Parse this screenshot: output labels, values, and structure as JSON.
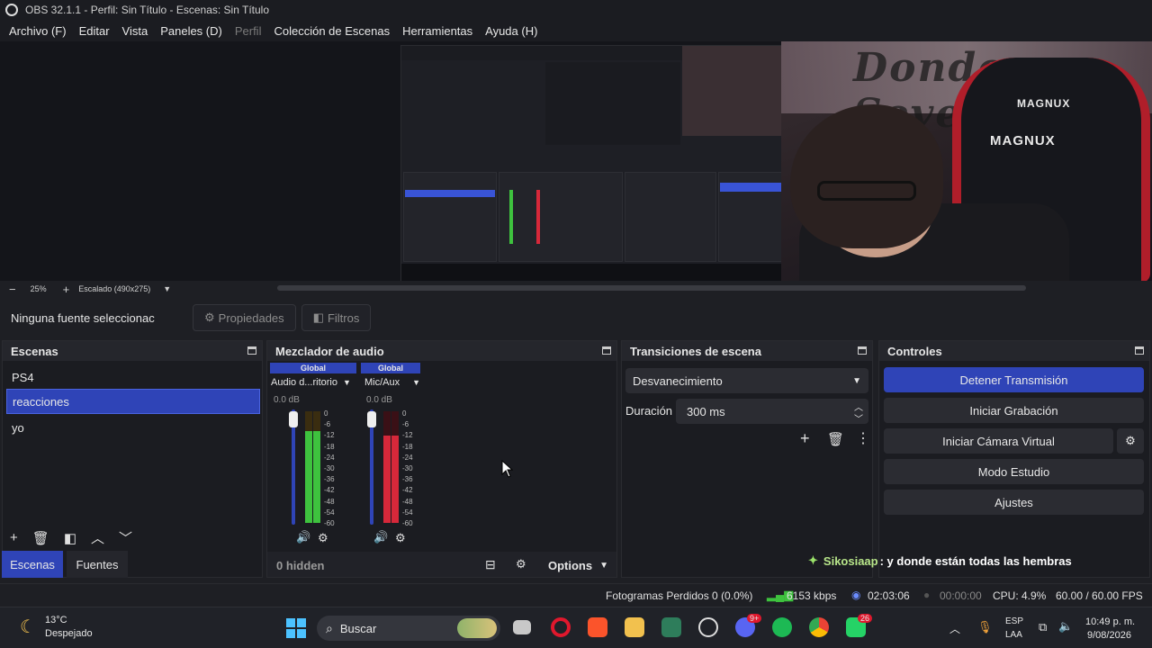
{
  "titlebar": {
    "title": "OBS 32.1.1 - Perfil: Sin Título - Escenas: Sin Título"
  },
  "menu": [
    {
      "label": "Archivo (F)",
      "enabled": true
    },
    {
      "label": "Editar",
      "enabled": true
    },
    {
      "label": "Vista",
      "enabled": true
    },
    {
      "label": "Paneles (D)",
      "enabled": true
    },
    {
      "label": "Perfil",
      "enabled": false
    },
    {
      "label": "Colección de Escenas",
      "enabled": true
    },
    {
      "label": "Herramientas",
      "enabled": true
    },
    {
      "label": "Ayuda (H)",
      "enabled": true
    }
  ],
  "webcam": {
    "graffiti_text": "Donde Seven",
    "chair_brand": "MAGNUX"
  },
  "zoombar": {
    "zoom_out": "−",
    "zoom": "25%",
    "zoom_in": "+",
    "scaling": "Escalado (490x275)"
  },
  "sourcebar": {
    "selection": "Ninguna fuente seleccionac",
    "properties": "Propiedades",
    "filters": "Filtros"
  },
  "scenes": {
    "title": "Escenas",
    "items": [
      {
        "label": "PS4",
        "selected": false
      },
      {
        "label": "reacciones",
        "selected": true
      },
      {
        "label": "yo",
        "selected": false
      }
    ],
    "tabs": [
      {
        "label": "Escenas",
        "active": true
      },
      {
        "label": "Fuentes",
        "active": false
      }
    ]
  },
  "mixer": {
    "title": "Mezclador de audio",
    "channels": [
      {
        "badge": "Global",
        "name": "Audio d...ritorio",
        "db": "0.0 dB",
        "level": 0.82
      },
      {
        "badge": "Global",
        "name": "Mic/Aux",
        "db": "0.0 dB",
        "level": 0.78
      }
    ],
    "ticks": [
      "0",
      "-6",
      "-12",
      "-18",
      "-24",
      "-30",
      "-36",
      "-42",
      "-48",
      "-54",
      "-60"
    ],
    "hidden": "0 hidden",
    "options": "Options"
  },
  "transitions": {
    "title": "Transiciones de escena",
    "selected": "Desvanecimiento",
    "duration_label": "Duración",
    "duration_value": "300 ms"
  },
  "controls": {
    "title": "Controles",
    "buttons": [
      {
        "label": "Detener Transmisión",
        "primary": true
      },
      {
        "label": "Iniciar Grabación",
        "primary": false
      },
      {
        "label": "Iniciar Cámara Virtual",
        "primary": false
      },
      {
        "label": "Modo Estudio",
        "primary": false
      },
      {
        "label": "Ajustes",
        "primary": false
      }
    ]
  },
  "chat": {
    "user": "Sikosiaap",
    "message": ": y donde están todas las hembras"
  },
  "status": {
    "dropped": "Fotogramas Perdidos 0 (0.0%)",
    "bitrate": "6153 kbps",
    "stream_time": "02:03:06",
    "rec_time": "00:00:00",
    "cpu": "CPU: 4.9%",
    "fps": "60.00 / 60.00 FPS"
  },
  "taskbar": {
    "weather_temp": "13°C",
    "weather_desc": "Despejado",
    "search": "Buscar",
    "discord_badge": "9+",
    "whatsapp_badge": "26",
    "lang": "ESP",
    "layout": "LAA",
    "time": "10:49 p. m.",
    "date": "9/08/2026"
  },
  "colors": {
    "accent": "#2f44b7",
    "meter_green": "#3ec23e",
    "meter_red": "#d6283a",
    "chat_name": "#b8e68a"
  }
}
